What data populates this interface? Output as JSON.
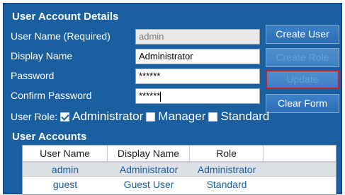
{
  "details": {
    "title": "User Account Details",
    "fields": [
      {
        "label": "User Name (Required)",
        "value": "admin"
      },
      {
        "label": "Display Name",
        "value": "Administrator"
      },
      {
        "label": "Password",
        "value": "******"
      },
      {
        "label": "Confirm Password",
        "value": "******"
      }
    ],
    "role_label": "User Role:",
    "roles": [
      {
        "label": "Administrator",
        "checked": true
      },
      {
        "label": "Manager",
        "checked": false
      },
      {
        "label": "Standard",
        "checked": false
      }
    ]
  },
  "buttons": {
    "create_user": "Create User",
    "create_role": "Create Role",
    "update": "Update",
    "clear_form": "Clear Form"
  },
  "accounts": {
    "title": "User Accounts",
    "columns": [
      "User Name",
      "Display Name",
      "Role"
    ],
    "rows": [
      {
        "user_name": "admin",
        "display_name": "Administrator",
        "role": "Administrator"
      },
      {
        "user_name": "guest",
        "display_name": "Guest User",
        "role": "Standard"
      }
    ]
  },
  "colors": {
    "panel": "#1a5fa0",
    "focus_border": "#cc1f2e"
  }
}
